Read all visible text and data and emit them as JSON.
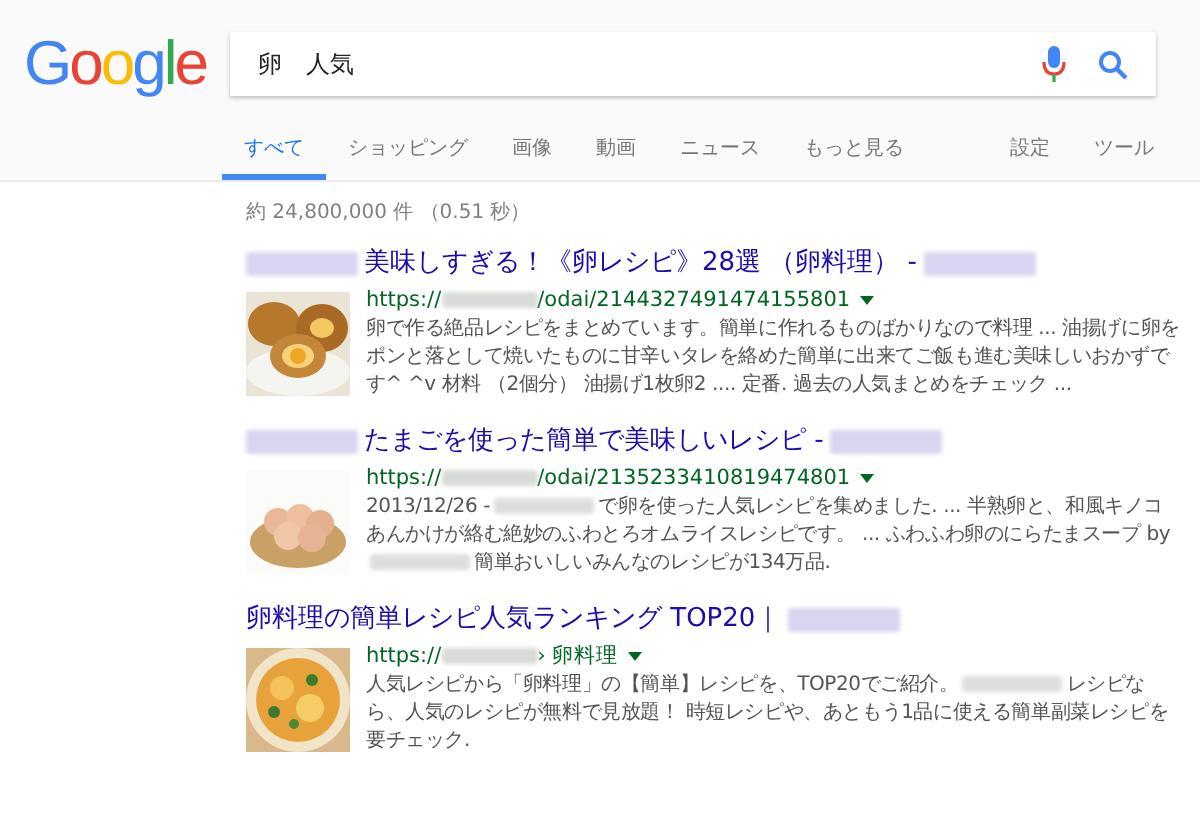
{
  "logo": "Google",
  "search": {
    "value": "卵　人気"
  },
  "tabs": [
    {
      "label": "すべて",
      "selected": true
    },
    {
      "label": "ショッピング",
      "selected": false
    },
    {
      "label": "画像",
      "selected": false
    },
    {
      "label": "動画",
      "selected": false
    },
    {
      "label": "ニュース",
      "selected": false
    },
    {
      "label": "もっと見る",
      "selected": false
    }
  ],
  "tools": [
    "設定",
    "ツール"
  ],
  "stats": "約 24,800,000 件 （0.51 秒）",
  "results": [
    {
      "title": [
        {
          "kind": "blur"
        },
        {
          "kind": "text",
          "text": "美味しすぎる！《卵レシピ》28選 （卵料理） -"
        },
        {
          "kind": "blur"
        }
      ],
      "url": [
        {
          "kind": "text",
          "text": "https://"
        },
        {
          "kind": "blur"
        },
        {
          "kind": "text",
          "text": "/odai/2144327491474155801"
        }
      ],
      "snippet": [
        {
          "kind": "text",
          "text": "卵で作る絶品レシピをまとめています。簡単に作れるものばかりなので料理 ... 油揚げに卵をポンと落として焼いたものに甘辛いタレを絡めた簡単に出来てご飯も進む美味しいおかずです^ ^v 材料 （2個分） 油揚げ1枚卵2 .... 定番. 過去の人気まとめをチェック ..."
        }
      ],
      "thumbnail": {
        "kind": "picture"
      }
    },
    {
      "title": [
        {
          "kind": "blur"
        },
        {
          "kind": "text",
          "text": "たまごを使った簡単で美味しいレシピ -"
        },
        {
          "kind": "blur"
        }
      ],
      "url": [
        {
          "kind": "text",
          "text": "https://"
        },
        {
          "kind": "blur"
        },
        {
          "kind": "text",
          "text": "/odai/2135233410819474801"
        }
      ],
      "snippet": [
        {
          "kind": "text",
          "text": "2013/12/26 -"
        },
        {
          "kind": "blur"
        },
        {
          "kind": "text",
          "text": "で卵を使った人気レシピを集めました. ... 半熟卵と、和風キノコあんかけが絡む絶妙のふわとろオムライスレシピです。 ... ふわふわ卵のにらたまスープ by"
        },
        {
          "kind": "blur"
        },
        {
          "kind": "text",
          "text": "簡単おいしいみんなのレシピが134万品."
        }
      ],
      "thumbnail": {
        "kind": "picture"
      }
    },
    {
      "title": [
        {
          "kind": "text",
          "text": "卵料理の簡単レシピ人気ランキング TOP20｜"
        },
        {
          "kind": "blur"
        }
      ],
      "url": [
        {
          "kind": "text",
          "text": "https://"
        },
        {
          "kind": "blur"
        },
        {
          "kind": "text",
          "text": "› 卵料理"
        }
      ],
      "snippet": [
        {
          "kind": "text",
          "text": "人気レシピから「卵料理」の【簡単】レシピを、TOP20でご紹介。"
        },
        {
          "kind": "blur"
        },
        {
          "kind": "text",
          "text": "レシピなら、人気のレシピが無料で見放題！ 時短レシピや、あともう1品に使える簡単副菜レシピを要チェック."
        }
      ],
      "thumbnail": {
        "kind": "picture"
      }
    }
  ]
}
